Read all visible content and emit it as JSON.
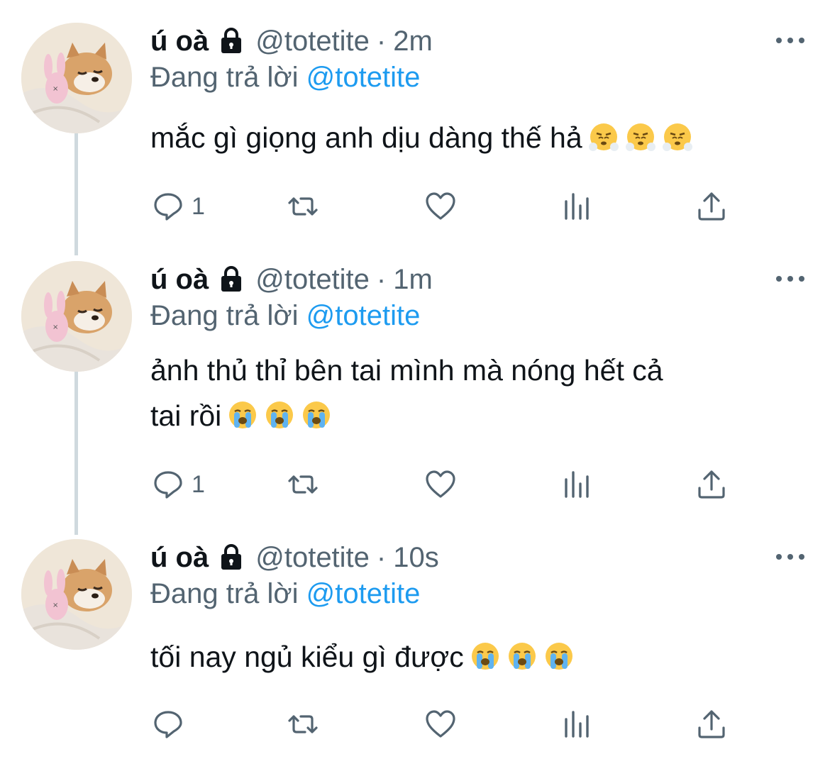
{
  "tweets": [
    {
      "display_name": "ú oà",
      "handle": "@totetite",
      "separator": "·",
      "time": "2m",
      "reply_prefix": "Đang trả lời",
      "reply_to": "@totetite",
      "text": "mắc gì giọng anh dịu dàng thế hả",
      "emoji": "face-with-steam",
      "emoji_count": 3,
      "reply_count": "1"
    },
    {
      "display_name": "ú oà",
      "handle": "@totetite",
      "separator": "·",
      "time": "1m",
      "reply_prefix": "Đang trả lời",
      "reply_to": "@totetite",
      "text_line1": "ảnh thủ thỉ bên tai mình mà nóng hết cả",
      "text_line2": "tai rồi",
      "emoji": "loudly-crying-face",
      "emoji_count": 3,
      "reply_count": "1"
    },
    {
      "display_name": "ú oà",
      "handle": "@totetite",
      "separator": "·",
      "time": "10s",
      "reply_prefix": "Đang trả lời",
      "reply_to": "@totetite",
      "text": "tối nay ngủ kiểu gì được",
      "emoji": "loudly-crying-face",
      "emoji_count": 3,
      "reply_count": ""
    }
  ],
  "colors": {
    "text": "#0f1419",
    "secondary": "#536471",
    "link": "#1d9bf0",
    "thread_line": "#cfd9de"
  }
}
